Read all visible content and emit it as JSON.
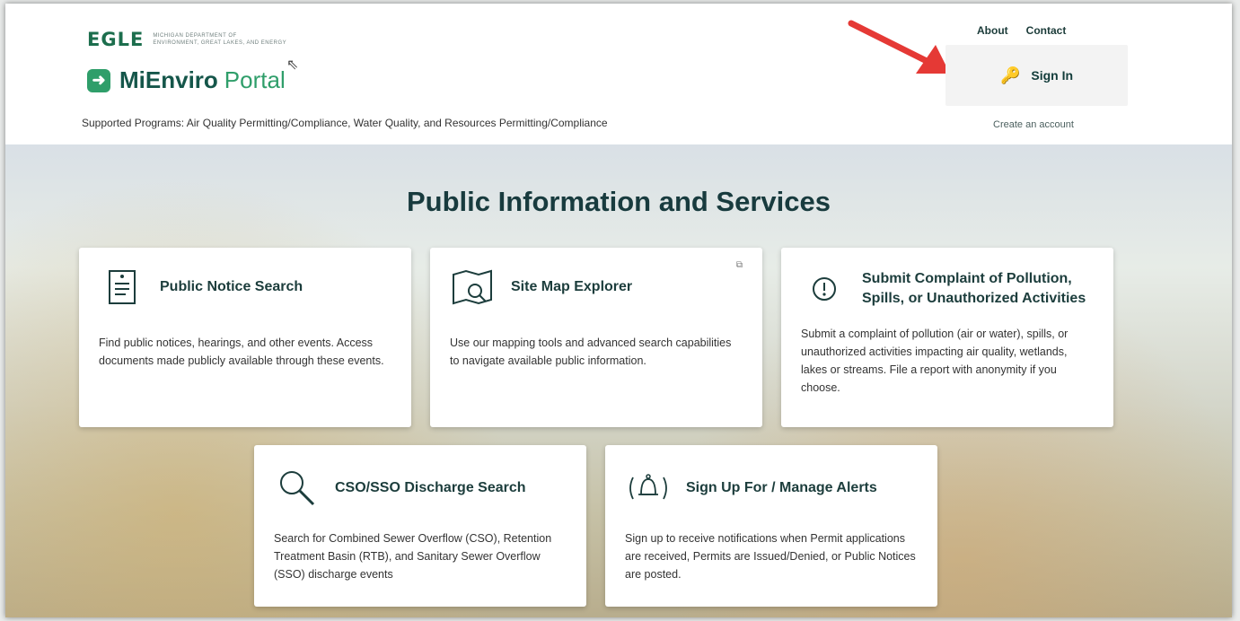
{
  "header": {
    "egle_mark": "EGLE",
    "egle_line1": "MICHIGAN DEPARTMENT OF",
    "egle_line2": "ENVIRONMENT, GREAT LAKES, AND ENERGY",
    "brand_name": "MiEnviro",
    "brand_sub": "Portal",
    "supported_programs": "Supported Programs: Air Quality Permitting/Compliance, Water Quality, and Resources Permitting/Compliance",
    "links": {
      "about": "About",
      "contact": "Contact"
    },
    "signin_label": "Sign In",
    "create_account": "Create an account"
  },
  "hero": {
    "title": "Public Information and Services"
  },
  "cards": [
    {
      "title": "Public Notice Search",
      "desc": "Find public notices, hearings, and other events. Access documents made publicly available through these events.",
      "icon": "document-icon"
    },
    {
      "title": "Site Map Explorer",
      "desc": "Use our mapping tools and advanced search capabilities to navigate available public information.",
      "icon": "map-search-icon"
    },
    {
      "title": "Submit Complaint of Pollution, Spills, or Unauthorized Activities",
      "desc": "Submit a complaint of pollution (air or water), spills, or unauthorized activities impacting air quality, wetlands, lakes or streams. File a report with anonymity if you choose.",
      "icon": "exclamation-icon"
    },
    {
      "title": "CSO/SSO Discharge Search",
      "desc": "Search for Combined Sewer Overflow (CSO), Retention Treatment Basin (RTB), and Sanitary Sewer Overflow (SSO) discharge events",
      "icon": "magnifier-icon"
    },
    {
      "title": "Sign Up For / Manage Alerts",
      "desc": "Sign up to receive notifications when Permit applications are received, Permits are Issued/Denied, or Public Notices are posted.",
      "icon": "bell-icon"
    }
  ],
  "colors": {
    "brand_green": "#2f9e6a",
    "title_color": "#183b3e",
    "arrow_red": "#e53935"
  }
}
